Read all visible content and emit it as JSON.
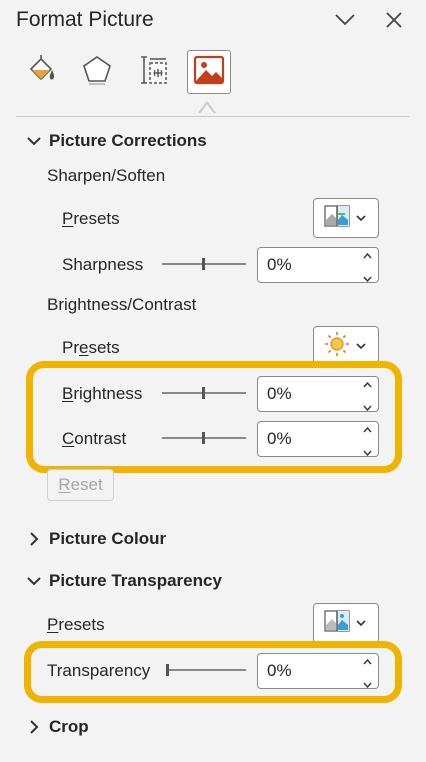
{
  "pane": {
    "title": "Format Picture"
  },
  "header": {
    "collapse_icon": "chevron-down-icon",
    "close_icon": "close-icon"
  },
  "tabs": [
    {
      "name": "fill-line",
      "icon": "paint-bucket-icon"
    },
    {
      "name": "effects",
      "icon": "pentagon-icon"
    },
    {
      "name": "size-properties",
      "icon": "size-position-icon"
    },
    {
      "name": "picture",
      "icon": "picture-icon",
      "active": true
    }
  ],
  "sections": {
    "corrections": {
      "title": "Picture Corrections",
      "sharpen_soften": "Sharpen/Soften",
      "presets_1": {
        "u": "P",
        "rest": "resets"
      },
      "sharpness": {
        "label": "Sharpness",
        "value": "0%"
      },
      "brightness_contrast": "Brightness/Contrast",
      "presets_2": {
        "pre": "Pr",
        "u": "e",
        "rest": "sets"
      },
      "brightness": {
        "u": "B",
        "rest": "rightness",
        "value": "0%"
      },
      "contrast": {
        "u": "C",
        "rest": "ontrast",
        "value": "0%"
      },
      "reset": {
        "u": "R",
        "rest": "eset"
      }
    },
    "colour": {
      "title": "Picture Colour"
    },
    "transparency": {
      "title": "Picture Transparency",
      "presets": {
        "u": "P",
        "rest": "resets"
      },
      "transparency": {
        "label": "Transparency",
        "value": "0%"
      }
    },
    "crop": {
      "title": "Crop"
    }
  },
  "colors": {
    "highlight": "#f0b400",
    "accent": "#c43e1c"
  }
}
